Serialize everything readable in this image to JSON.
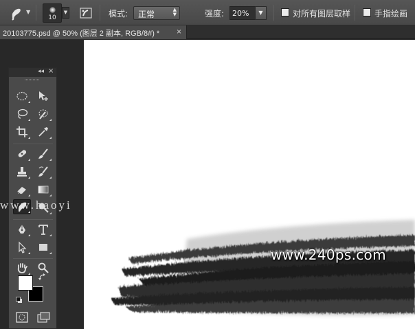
{
  "options_bar": {
    "brush_size": "10",
    "mode_label": "模式:",
    "mode_value": "正常",
    "strength_label": "强度:",
    "strength_value": "20%",
    "sample_all_layers_label": "对所有图层取样",
    "sample_all_layers_checked": false,
    "finger_painting_label": "手指绘画",
    "finger_painting_checked": false
  },
  "document_tab": {
    "title": "20103775.psd @ 50% (图层 2 副本, RGB/8#) *",
    "close_glyph": "×"
  },
  "tools_panel": {
    "collapse_glyph": "◂◂",
    "close_glyph": "×",
    "active_tool": "smudge-tool",
    "foreground_color": "#ffffff",
    "background_color": "#000000"
  },
  "canvas": {
    "watermark_text": "www.240ps.com"
  },
  "overlay": {
    "watermark_text": "www.haoyi"
  },
  "colors": {
    "options_bar": "#4d4d4d",
    "workspace": "#282828",
    "panel": "#4a4a4a",
    "canvas": "#ffffff"
  }
}
